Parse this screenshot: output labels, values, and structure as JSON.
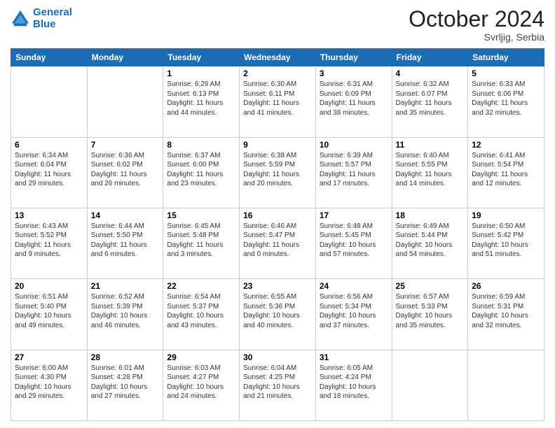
{
  "header": {
    "logo_line1": "General",
    "logo_line2": "Blue",
    "month": "October 2024",
    "location": "Svrljig, Serbia"
  },
  "days_of_week": [
    "Sunday",
    "Monday",
    "Tuesday",
    "Wednesday",
    "Thursday",
    "Friday",
    "Saturday"
  ],
  "weeks": [
    [
      {
        "day": "",
        "sunrise": "",
        "sunset": "",
        "daylight": ""
      },
      {
        "day": "",
        "sunrise": "",
        "sunset": "",
        "daylight": ""
      },
      {
        "day": "1",
        "sunrise": "Sunrise: 6:29 AM",
        "sunset": "Sunset: 6:13 PM",
        "daylight": "Daylight: 11 hours and 44 minutes."
      },
      {
        "day": "2",
        "sunrise": "Sunrise: 6:30 AM",
        "sunset": "Sunset: 6:11 PM",
        "daylight": "Daylight: 11 hours and 41 minutes."
      },
      {
        "day": "3",
        "sunrise": "Sunrise: 6:31 AM",
        "sunset": "Sunset: 6:09 PM",
        "daylight": "Daylight: 11 hours and 38 minutes."
      },
      {
        "day": "4",
        "sunrise": "Sunrise: 6:32 AM",
        "sunset": "Sunset: 6:07 PM",
        "daylight": "Daylight: 11 hours and 35 minutes."
      },
      {
        "day": "5",
        "sunrise": "Sunrise: 6:33 AM",
        "sunset": "Sunset: 6:06 PM",
        "daylight": "Daylight: 11 hours and 32 minutes."
      }
    ],
    [
      {
        "day": "6",
        "sunrise": "Sunrise: 6:34 AM",
        "sunset": "Sunset: 6:04 PM",
        "daylight": "Daylight: 11 hours and 29 minutes."
      },
      {
        "day": "7",
        "sunrise": "Sunrise: 6:36 AM",
        "sunset": "Sunset: 6:02 PM",
        "daylight": "Daylight: 11 hours and 26 minutes."
      },
      {
        "day": "8",
        "sunrise": "Sunrise: 6:37 AM",
        "sunset": "Sunset: 6:00 PM",
        "daylight": "Daylight: 11 hours and 23 minutes."
      },
      {
        "day": "9",
        "sunrise": "Sunrise: 6:38 AM",
        "sunset": "Sunset: 5:59 PM",
        "daylight": "Daylight: 11 hours and 20 minutes."
      },
      {
        "day": "10",
        "sunrise": "Sunrise: 6:39 AM",
        "sunset": "Sunset: 5:57 PM",
        "daylight": "Daylight: 11 hours and 17 minutes."
      },
      {
        "day": "11",
        "sunrise": "Sunrise: 6:40 AM",
        "sunset": "Sunset: 5:55 PM",
        "daylight": "Daylight: 11 hours and 14 minutes."
      },
      {
        "day": "12",
        "sunrise": "Sunrise: 6:41 AM",
        "sunset": "Sunset: 5:54 PM",
        "daylight": "Daylight: 11 hours and 12 minutes."
      }
    ],
    [
      {
        "day": "13",
        "sunrise": "Sunrise: 6:43 AM",
        "sunset": "Sunset: 5:52 PM",
        "daylight": "Daylight: 11 hours and 9 minutes."
      },
      {
        "day": "14",
        "sunrise": "Sunrise: 6:44 AM",
        "sunset": "Sunset: 5:50 PM",
        "daylight": "Daylight: 11 hours and 6 minutes."
      },
      {
        "day": "15",
        "sunrise": "Sunrise: 6:45 AM",
        "sunset": "Sunset: 5:48 PM",
        "daylight": "Daylight: 11 hours and 3 minutes."
      },
      {
        "day": "16",
        "sunrise": "Sunrise: 6:46 AM",
        "sunset": "Sunset: 5:47 PM",
        "daylight": "Daylight: 11 hours and 0 minutes."
      },
      {
        "day": "17",
        "sunrise": "Sunrise: 6:48 AM",
        "sunset": "Sunset: 5:45 PM",
        "daylight": "Daylight: 10 hours and 57 minutes."
      },
      {
        "day": "18",
        "sunrise": "Sunrise: 6:49 AM",
        "sunset": "Sunset: 5:44 PM",
        "daylight": "Daylight: 10 hours and 54 minutes."
      },
      {
        "day": "19",
        "sunrise": "Sunrise: 6:50 AM",
        "sunset": "Sunset: 5:42 PM",
        "daylight": "Daylight: 10 hours and 51 minutes."
      }
    ],
    [
      {
        "day": "20",
        "sunrise": "Sunrise: 6:51 AM",
        "sunset": "Sunset: 5:40 PM",
        "daylight": "Daylight: 10 hours and 49 minutes."
      },
      {
        "day": "21",
        "sunrise": "Sunrise: 6:52 AM",
        "sunset": "Sunset: 5:39 PM",
        "daylight": "Daylight: 10 hours and 46 minutes."
      },
      {
        "day": "22",
        "sunrise": "Sunrise: 6:54 AM",
        "sunset": "Sunset: 5:37 PM",
        "daylight": "Daylight: 10 hours and 43 minutes."
      },
      {
        "day": "23",
        "sunrise": "Sunrise: 6:55 AM",
        "sunset": "Sunset: 5:36 PM",
        "daylight": "Daylight: 10 hours and 40 minutes."
      },
      {
        "day": "24",
        "sunrise": "Sunrise: 6:56 AM",
        "sunset": "Sunset: 5:34 PM",
        "daylight": "Daylight: 10 hours and 37 minutes."
      },
      {
        "day": "25",
        "sunrise": "Sunrise: 6:57 AM",
        "sunset": "Sunset: 5:33 PM",
        "daylight": "Daylight: 10 hours and 35 minutes."
      },
      {
        "day": "26",
        "sunrise": "Sunrise: 6:59 AM",
        "sunset": "Sunset: 5:31 PM",
        "daylight": "Daylight: 10 hours and 32 minutes."
      }
    ],
    [
      {
        "day": "27",
        "sunrise": "Sunrise: 6:00 AM",
        "sunset": "Sunset: 4:30 PM",
        "daylight": "Daylight: 10 hours and 29 minutes."
      },
      {
        "day": "28",
        "sunrise": "Sunrise: 6:01 AM",
        "sunset": "Sunset: 4:28 PM",
        "daylight": "Daylight: 10 hours and 27 minutes."
      },
      {
        "day": "29",
        "sunrise": "Sunrise: 6:03 AM",
        "sunset": "Sunset: 4:27 PM",
        "daylight": "Daylight: 10 hours and 24 minutes."
      },
      {
        "day": "30",
        "sunrise": "Sunrise: 6:04 AM",
        "sunset": "Sunset: 4:25 PM",
        "daylight": "Daylight: 10 hours and 21 minutes."
      },
      {
        "day": "31",
        "sunrise": "Sunrise: 6:05 AM",
        "sunset": "Sunset: 4:24 PM",
        "daylight": "Daylight: 10 hours and 18 minutes."
      },
      {
        "day": "",
        "sunrise": "",
        "sunset": "",
        "daylight": ""
      },
      {
        "day": "",
        "sunrise": "",
        "sunset": "",
        "daylight": ""
      }
    ]
  ]
}
